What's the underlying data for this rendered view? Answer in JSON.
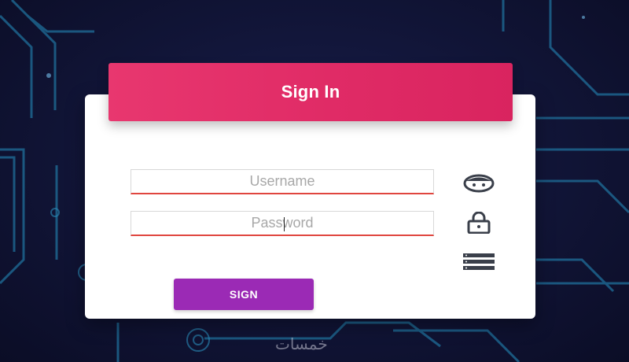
{
  "header": {
    "title": "Sign In"
  },
  "form": {
    "username_placeholder": "Username",
    "password_placeholder": "Password",
    "submit_label": "SIGN"
  },
  "icons": {
    "username": "face-icon",
    "password": "lock-icon",
    "extra": "server-icon"
  },
  "watermark": "خمسات",
  "colors": {
    "header_accent": "#e02b66",
    "button": "#9b2ab5",
    "input_underline": "#e0463f",
    "background": "#12163a"
  }
}
